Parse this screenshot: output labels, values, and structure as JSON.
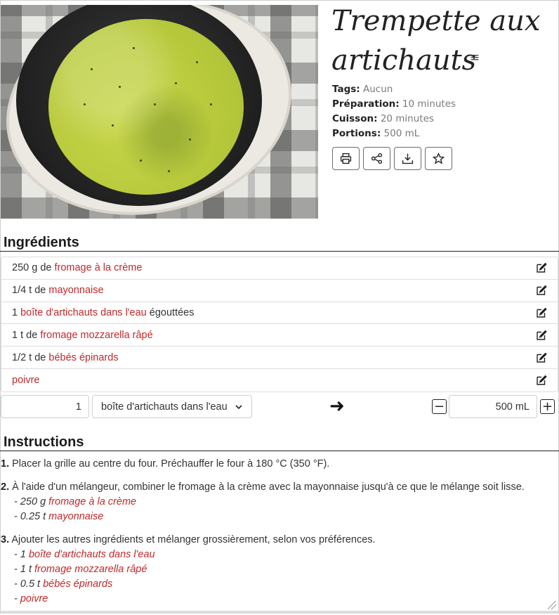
{
  "recipe": {
    "title": "Trempette aux artichauts",
    "meta": [
      {
        "key": "Tags:",
        "value": "Aucun"
      },
      {
        "key": "Préparation:",
        "value": "10 minutes"
      },
      {
        "key": "Cuisson:",
        "value": "20 minutes"
      },
      {
        "key": "Portions:",
        "value": "500 mL"
      }
    ],
    "actions": [
      "printer-icon",
      "share-icon",
      "download-icon",
      "star-icon"
    ],
    "menu_icon": "≡"
  },
  "ingredients": {
    "heading": "Ingrédients",
    "items": [
      {
        "qty": "250 g de ",
        "name": "fromage à la crème",
        "rest": ""
      },
      {
        "qty": "1/4 t de ",
        "name": "mayonnaise",
        "rest": ""
      },
      {
        "qty": "1 ",
        "name": "boîte d'artichauts dans l'eau",
        "rest": " égouttées"
      },
      {
        "qty": "1 t de ",
        "name": "fromage mozzarella râpé",
        "rest": ""
      },
      {
        "qty": "1/2 t de ",
        "name": "bébés épinards",
        "rest": ""
      },
      {
        "qty": "",
        "name": "poivre",
        "rest": ""
      }
    ]
  },
  "converter": {
    "quantity": "1",
    "unit": "boîte d'artichauts dans l'eau",
    "arrow": "➜",
    "yield": "500 mL",
    "minus": "−",
    "plus": "+"
  },
  "instructions": {
    "heading": "Instructions",
    "steps": [
      {
        "num": "1.",
        "text": " Placer la grille au centre du four. Préchauffer le four à 180 °C (350 °F).",
        "subs": []
      },
      {
        "num": "2.",
        "text": " À l'aide d'un mélangeur, combiner le fromage à la crème avec la mayonnaise jusqu'à ce que le mélange soit lisse.",
        "subs": [
          {
            "amount": "- 250 g ",
            "name": "fromage à la crème"
          },
          {
            "amount": "- 0.25 t ",
            "name": "mayonnaise"
          }
        ]
      },
      {
        "num": "3.",
        "text": " Ajouter les autres ingrédients et mélanger grossièrement, selon vos préférences.",
        "subs": [
          {
            "amount": "- 1 ",
            "name": "boîte d'artichauts dans l'eau"
          },
          {
            "amount": "- 1 t ",
            "name": "fromage mozzarella râpé"
          },
          {
            "amount": "- 0.5 t ",
            "name": "bébés épinards"
          },
          {
            "amount": "- ",
            "name": "poivre"
          }
        ]
      }
    ]
  },
  "colors": {
    "accent_red": "#c0292b",
    "dip_green": "#b7c93b"
  }
}
